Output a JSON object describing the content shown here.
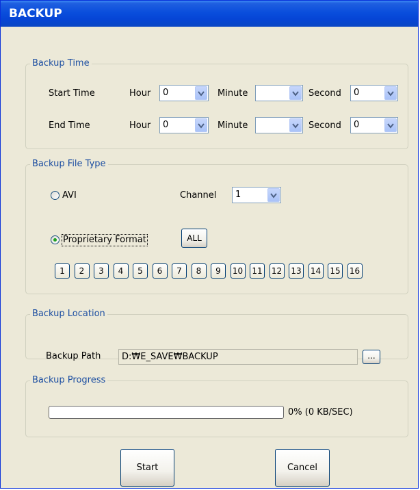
{
  "window": {
    "title": "BACKUP"
  },
  "backup_time": {
    "legend": "Backup Time",
    "start_label": "Start Time",
    "end_label": "End Time",
    "hour_label": "Hour",
    "minute_label": "Minute",
    "second_label": "Second",
    "start": {
      "hour": "0",
      "minute": "",
      "second": "0"
    },
    "end": {
      "hour": "0",
      "minute": "",
      "second": "0"
    }
  },
  "file_type": {
    "legend": "Backup File Type",
    "avi_label": "AVI",
    "avi_selected": false,
    "channel_label": "Channel",
    "channel_value": "1",
    "proprietary_label": "Proprietary Format",
    "proprietary_selected": true,
    "all_label": "ALL",
    "channels": [
      "1",
      "2",
      "3",
      "4",
      "5",
      "6",
      "7",
      "8",
      "9",
      "10",
      "11",
      "12",
      "13",
      "14",
      "15",
      "16"
    ]
  },
  "location": {
    "legend": "Backup Location",
    "path_label": "Backup Path",
    "path_value": "D:₩E_SAVE₩BACKUP",
    "browse_label": "..."
  },
  "progress": {
    "legend": "Backup Progress",
    "percent": 0,
    "status_text": "0% (0 KB/SEC)"
  },
  "buttons": {
    "start_label": "Start",
    "cancel_label": "Cancel"
  },
  "colors": {
    "title_bar": "#0a4edc",
    "legend_text": "#1c4ea1",
    "dialog_bg": "#ece9d8",
    "progress_fill": "#2fb52f"
  }
}
